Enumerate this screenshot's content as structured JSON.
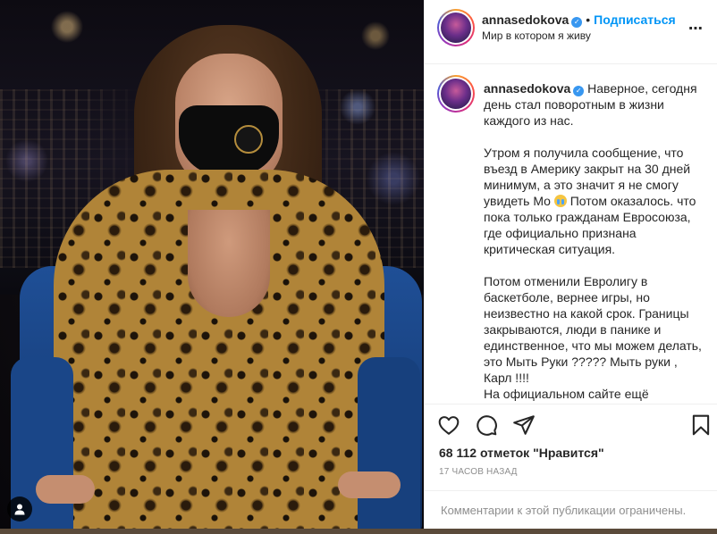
{
  "colors": {
    "follow_blue": "#0095f6",
    "verified_blue": "#3897f0",
    "text": "#262626",
    "muted": "#8e8e8e",
    "border": "#efefef"
  },
  "post": {
    "author": {
      "username": "annasedokova",
      "verified": true,
      "follow_label": "Подписаться",
      "location": "Мир в котором я живу"
    },
    "more_icon": "more-options-icon",
    "caption": {
      "username": "annasedokova",
      "text_part1": " Наверное, сегодня день стал поворотным в жизни каждого из нас.\n\nУтром я получила сообщение, что въезд в Америку закрыт на 30 дней минимум, а это значит я не смогу увидеть Мо ",
      "emoji": "crying-face",
      "text_part2": " Потом оказалось. что пока только гражданам Евросоюза, где официально признана критическая ситуация.\n\nПотом отменили Евролигу в баскетболе, вернее игры, но неизвестно на какой срок. Границы закрываются, люди в панике и единственное, что мы можем делать, это Мыть Руки ????? Мыть руки , Карл !!!!\nНа официальном сайте ещё"
    },
    "actions": {
      "like_icon": "heart-icon",
      "comment_icon": "comment-icon",
      "share_icon": "share-icon",
      "save_icon": "bookmark-icon"
    },
    "likes_text": "68 112 отметок \"Нравится\"",
    "time_text": "17 часов назад",
    "comments_limited_text": "Комментарии к этой публикации ограничены."
  },
  "photo": {
    "tag_icon": "user-tag-icon"
  }
}
